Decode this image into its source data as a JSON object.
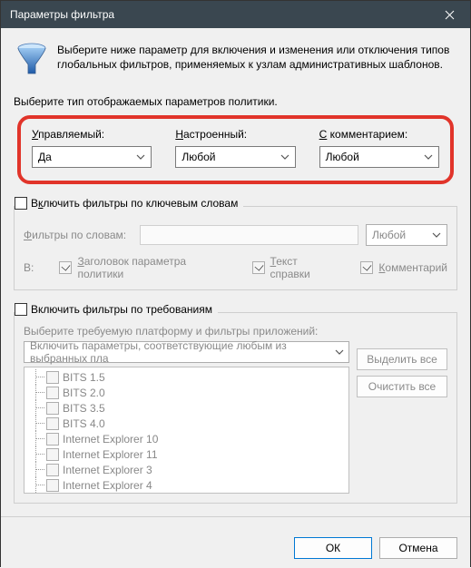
{
  "title": "Параметры фильтра",
  "intro": "Выберите ниже параметр для включения и изменения или отключения типов глобальных фильтров, применяемых к узлам административных шаблонов.",
  "section_label": "Выберите тип отображаемых параметров политики.",
  "filters": {
    "managed": {
      "label": "Управляемый:",
      "value": "Да"
    },
    "configured": {
      "label": "Настроенный:",
      "value": "Любой"
    },
    "commented": {
      "label": "С комментарием:",
      "value": "Любой"
    }
  },
  "keyword_group": {
    "title": "Включить фильтры по ключевым словам",
    "words_label": "Фильтры по словам:",
    "combo_value": "Любой",
    "in_label": "В:",
    "opt_title": "Заголовок параметра политики",
    "opt_help": "Текст справки",
    "opt_comment": "Комментарий"
  },
  "req_group": {
    "title": "Включить фильтры по требованиям",
    "subtitle": "Выберите требуемую платформу и фильтры приложений:",
    "combo_value": "Включить параметры, соответствующие любым из выбранных пла",
    "select_all": "Выделить все",
    "clear_all": "Очистить все",
    "items": [
      "BITS 1.5",
      "BITS 2.0",
      "BITS 3.5",
      "BITS 4.0",
      "Internet Explorer 10",
      "Internet Explorer 11",
      "Internet Explorer 3",
      "Internet Explorer 4"
    ]
  },
  "buttons": {
    "ok": "ОК",
    "cancel": "Отмена"
  }
}
